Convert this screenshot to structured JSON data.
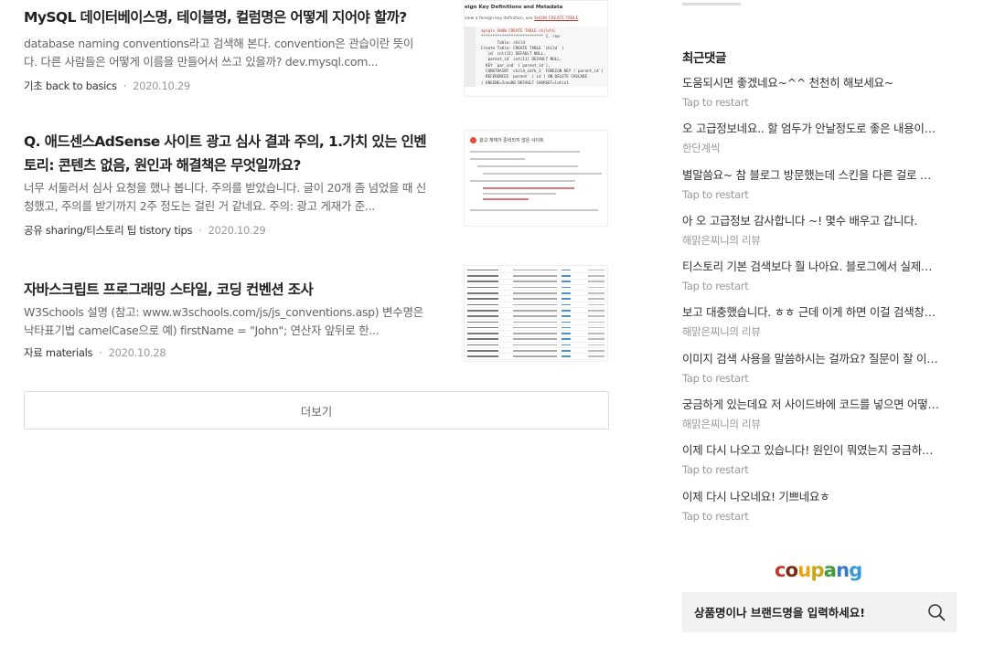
{
  "posts": [
    {
      "title": "MySQL 데이터베이스명, 테이블명, 컬럼명은 어떻게 지어야 할까?",
      "summary": "database naming conventions라고 검색해 본다. convention은 관습이란 뜻이다. 다른 사람들은 어떻게 이름을 만들어서 쓰고 있을까? dev.mysql.com...",
      "category": "기초 back to basics",
      "date": "2020.10.29",
      "thumb_heading": "eign Key Definitions and Metadata",
      "thumb_sub": "view a foreign key definition, use",
      "thumb_sub_code": "SHOW CREATE TABLE",
      "thumb_code": [
        "mysql> SHOW CREATE TABLE child\\G",
        "*************************** 1. row",
        "       Table: child",
        "Create Table: CREATE TABLE `child` (",
        "  `id` int(11) DEFAULT NULL,",
        "  `parent_id` int(11) DEFAULT NULL,",
        "  KEY `par_ind` (`parent_id`),",
        "  CONSTRAINT `child_ibfk_1` FOREIGN KEY (`parent_id`)",
        "  REFERENCES `parent` (`id`) ON DELETE CASCADE",
        ") ENGINE=InnoDB DEFAULT CHARSET=latin1"
      ]
    },
    {
      "title": "Q. 애드센스AdSense 사이트 광고 심사 결과 주의, 1.가치 있는 인벤토리: 콘텐츠 없음, 원인과 해결책은 무엇일까요?",
      "summary": "너무 서둘러서 심사 요청을 했나 봅니다. 주의를 받았습니다. 글이 20개 좀 넘었을 때 신청했고, 주의를 받기까지 2주 정도는 걸린 거 같네요. 주의: 광고 게재가 준...",
      "category": "공유 sharing/티스토리 팁 tistory tips",
      "date": "2020.10.29",
      "thumb_heading": "광고 게재가 준비되지 않은 사이트"
    },
    {
      "title": "자바스크립트 프로그래밍 스타일, 코딩 컨벤션 조사",
      "summary": "W3Schools 설명 (참고: www.w3schools.com/js/js_conventions.asp) 변수명은 낙타표기법 camelCase으로 예) firstName = \"John\"; 연산자 앞뒤로 한...",
      "category": "자료 materials",
      "date": "2020.10.28"
    }
  ],
  "more_label": "더보기",
  "sidebar": {
    "heading": "최근댓글",
    "comments": [
      {
        "text": "도움되시면 좋겠네요~^^ 천천히 해보세요~",
        "author": "Tap to restart"
      },
      {
        "text": "오 고급정보네요.. 할 엄두가 안날정도로 좋은 내용이네요.",
        "author": "한단계씩"
      },
      {
        "text": "별말씀요~ 참 블로그 방문했는데 스킨을 다른 걸로 바꾸셨네요.",
        "author": "Tap to restart"
      },
      {
        "text": "아 오 고급정보 감사합니다 ~! 몇수 배우고 갑니다.",
        "author": "해맑은찌니의 리뷰"
      },
      {
        "text": "티스토리 기본 검색보다 훨 나아요. 블로그에서 실제로 써보세요.",
        "author": "Tap to restart"
      },
      {
        "text": "보고 대충했습니다. ㅎㅎ 근데 이게 하면 이걸 검색창에서 쓸 수 있나요?",
        "author": "해맑은찌니의 리뷰"
      },
      {
        "text": "이미지 검색 사용을 말씀하시는 걸까요? 질문이 잘 이해가 안 돼서요.",
        "author": "Tap to restart"
      },
      {
        "text": "궁금하게 있는데요 저 사이드바에 코드를 넣으면 어떻게 되나요?",
        "author": "해맑은찌니의 리뷰"
      },
      {
        "text": "이제 다시 나오고 있습니다! 원인이 뭐였는지 궁금하네요.",
        "author": "Tap to restart"
      },
      {
        "text": "이제 다시 나오네요! 기쁘네요ㅎ",
        "author": "Tap to restart"
      }
    ]
  },
  "coupang": {
    "logo_letters": [
      "c",
      "o",
      "u",
      "p",
      "a",
      "n",
      "g"
    ],
    "logo_colors": [
      "#c0392b",
      "#7a2b14",
      "#e8a413",
      "#c8a41a",
      "#3d9d3a",
      "#3a7bc0",
      "#3a9ad8"
    ],
    "search_placeholder": "상품명이나 브랜드명을 입력하세요!"
  },
  "colors": {
    "text": "#222222",
    "muted": "#999999",
    "border": "#dddddd",
    "search_bg": "#f2f2f2"
  }
}
